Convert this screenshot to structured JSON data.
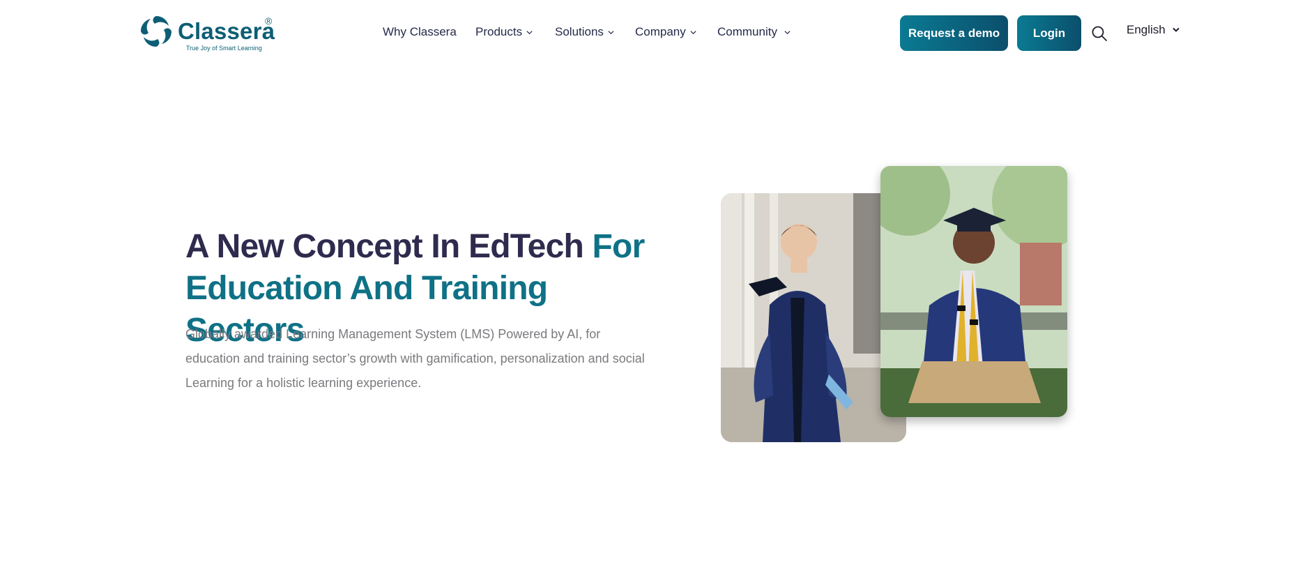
{
  "brand": {
    "name": "Classera",
    "registered": "®",
    "tagline": "True Joy of Smart Learning",
    "color": "#0d5e75"
  },
  "nav": {
    "items": [
      {
        "label": "Why Classera",
        "has_dropdown": false
      },
      {
        "label": "Products",
        "has_dropdown": true
      },
      {
        "label": "Solutions",
        "has_dropdown": true
      },
      {
        "label": "Company",
        "has_dropdown": true
      },
      {
        "label": "Community",
        "has_dropdown": true
      }
    ]
  },
  "actions": {
    "demo_label": "Request a demo",
    "login_label": "Login",
    "search_icon": "search-icon",
    "language": "English"
  },
  "hero": {
    "title_dark": "A New Concept In EdTech",
    "title_teal_1": "For",
    "title_teal_2": "Education And Training Sectors",
    "description": "Globally awarded Learning Management System (LMS) Powered by AI, for education and training sector’s growth with gamification, personalization and social Learning for a holistic learning experience."
  },
  "colors": {
    "accent": "#0f7186",
    "heading_dark": "#2e2b4e",
    "button_start": "#0b7a93",
    "button_end": "#0b4f6b",
    "body_text": "#7a7a7f"
  }
}
